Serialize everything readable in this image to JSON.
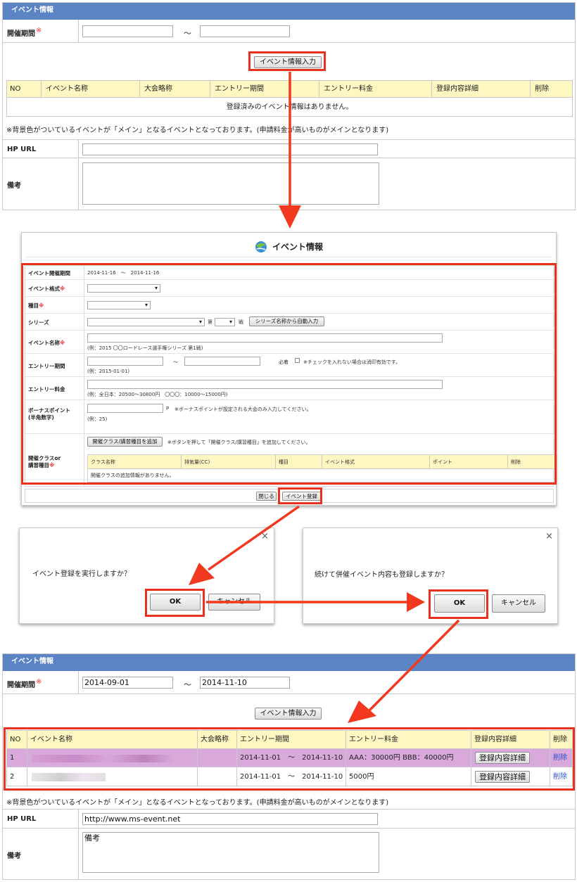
{
  "top_form": {
    "header": "イベント情報",
    "period_label": "開催期間",
    "required_mark": "※",
    "tilde": "～",
    "add_button": "イベント情報入力",
    "table_headers": [
      "NO",
      "イベント名称",
      "大会略称",
      "エントリー期間",
      "エントリー料金",
      "登録内容詳細",
      "削除"
    ],
    "empty_message": "登録済みのイベント情報はありません。",
    "note": "※背景色がついているイベントが「メイン」となるイベントとなっております。(申請料金が高いものがメインとなります)",
    "hp_url_label": "HP URL",
    "remarks_label": "備考"
  },
  "modal": {
    "title": "イベント情報",
    "rows": {
      "period_label": "イベント開催期間",
      "period_value": "2014-11-16　～　2014-11-16",
      "format_label": "イベント格式",
      "type_label": "種目",
      "series_label": "シリーズ",
      "series_dai": "第",
      "series_sen": "戦",
      "series_button": "シリーズ名称から自動入力",
      "name_label": "イベント名称",
      "name_hint": "(例：2015 〇〇ロードレース選手権シリーズ 第1戦)",
      "entry_label": "エントリー期間",
      "entry_tilde": "～",
      "entry_required": "必着",
      "entry_check_note": "※チェックを入れない場合は消印有効です。",
      "entry_hint": "(例：2015-01-01)",
      "fee_label": "エントリー料金",
      "fee_hint": "(例：全日本：20500～30800円　〇〇〇：10000～15000円)",
      "bonus_label": "ボーナスポイント",
      "bonus_label2": "(半角数字)",
      "bonus_unit": "P",
      "bonus_note": "※ボーナスポイントが設定される大会のみ入力してください。",
      "bonus_hint": "(例：25)",
      "class_label": "開催クラスor",
      "class_label2": "講習種目",
      "class_button": "開催クラス/講習種目を追加",
      "class_note": "※ボタンを押して「開催クラス/講習種目」を追加してください。",
      "class_headers": [
        "クラス名称",
        "排気量(CC)",
        "種目",
        "イベント格式",
        "ポイント",
        "削除"
      ],
      "class_empty": "開催クラスの追加情報がありません。"
    },
    "close_button": "閉じる",
    "register_button": "イベント登録"
  },
  "dialog1": {
    "message": "イベント登録を実行しますか？",
    "ok": "OK",
    "cancel": "キャンセル",
    "close": "×"
  },
  "dialog2": {
    "message": "続けて併催イベント内容も登録しますか？",
    "ok": "OK",
    "cancel": "キャンセル",
    "close": "×"
  },
  "bottom_form": {
    "header": "イベント情報",
    "period_label": "開催期間",
    "required_mark": "※",
    "start": "2014-09-01",
    "tilde": "～",
    "end": "2014-11-10",
    "add_button": "イベント情報入力",
    "table_headers": [
      "NO",
      "イベント名称",
      "大会略称",
      "エントリー期間",
      "エントリー料金",
      "登録内容詳細",
      "削除"
    ],
    "rows": [
      {
        "no": "1",
        "period": "2014-11-01　～　2014-11-10",
        "fee": "AAA：30000円 BBB：40000円",
        "detail": "登録内容詳細",
        "delete": "削除"
      },
      {
        "no": "2",
        "period": "2014-11-01　～　2014-11-10",
        "fee": "5000円",
        "detail": "登録内容詳細",
        "delete": "削除"
      }
    ],
    "note": "※背景色がついているイベントが「メイン」となるイベントとなっております。(申請料金が高いものがメインとなります)",
    "hp_url_label": "HP URL",
    "hp_url_value": "http://www.ms-event.net",
    "remarks_label": "備考",
    "remarks_value": "備考"
  },
  "colors": {
    "header_blue": "#5b84c4",
    "table_header_yellow": "#fff7c2",
    "main_row_purple": "#d9a9dc",
    "highlight_red": "#e8321f"
  }
}
